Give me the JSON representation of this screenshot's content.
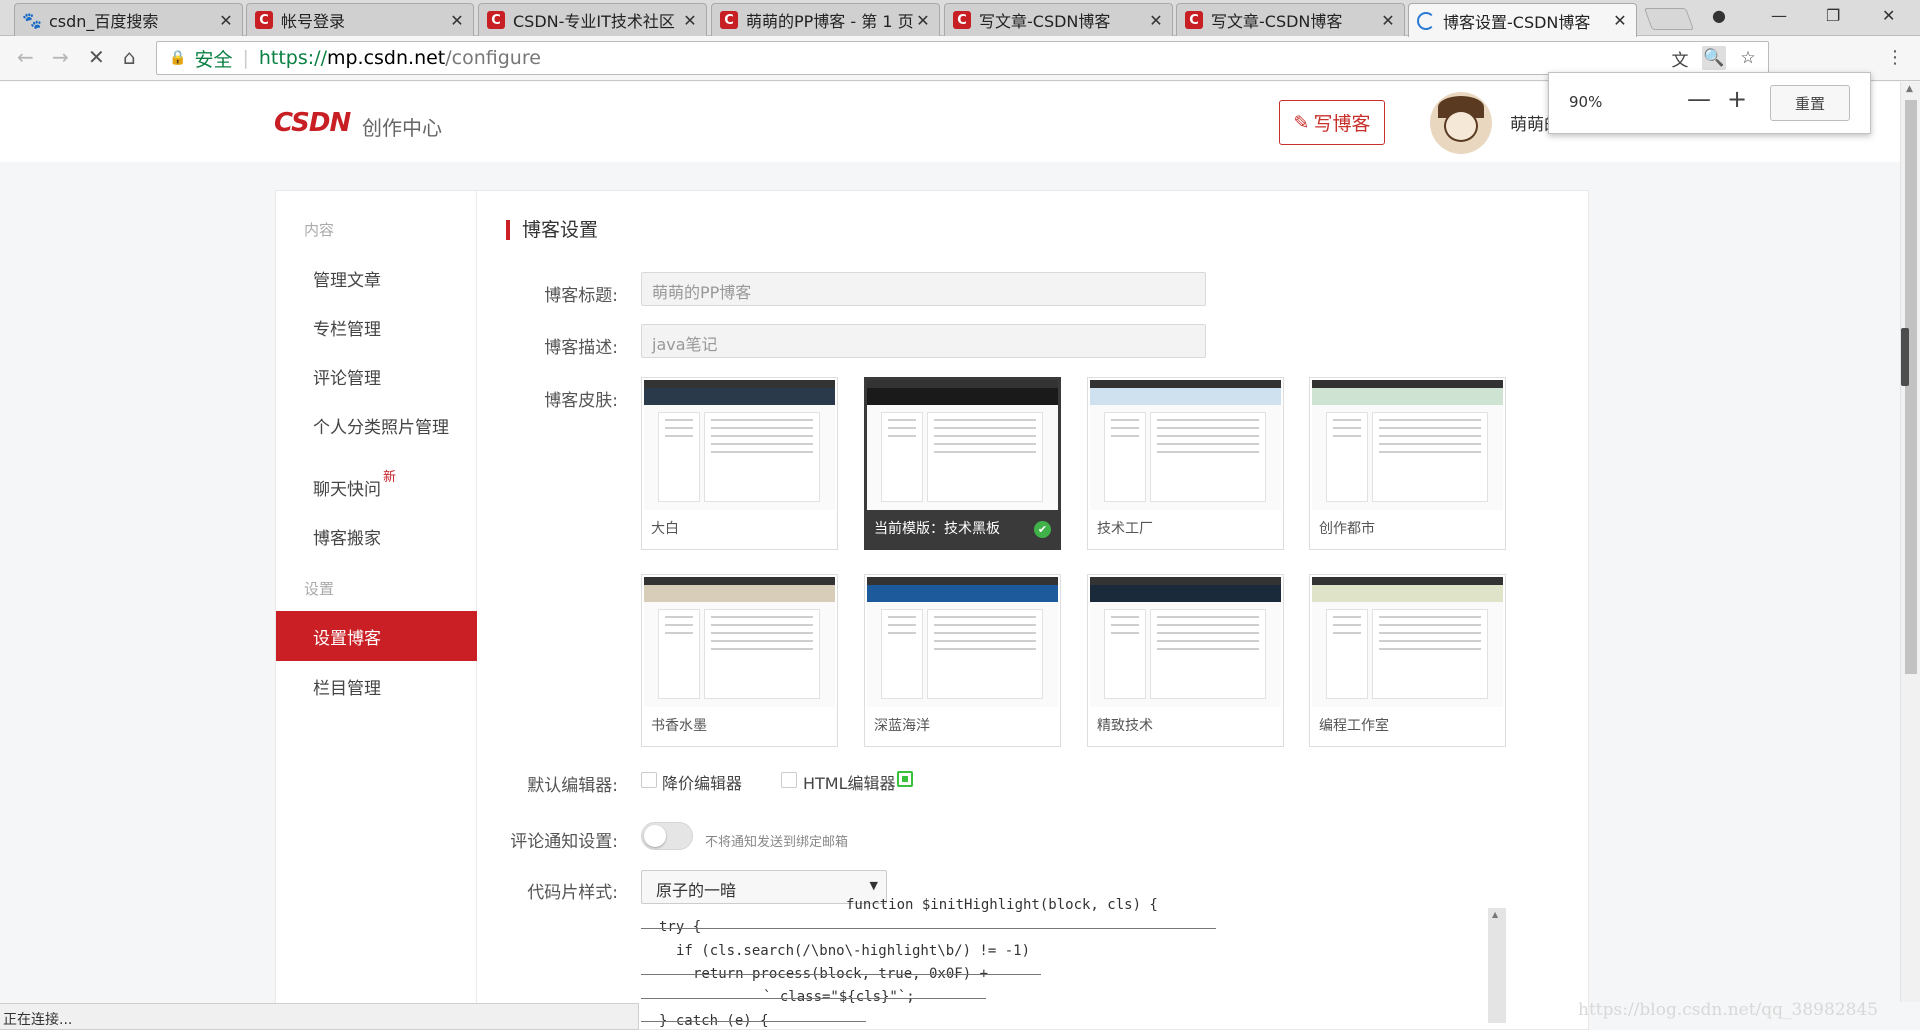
{
  "browser": {
    "tabs": [
      {
        "title": "csdn_百度搜索",
        "icon": "baidu-paw-icon"
      },
      {
        "title": "帐号登录",
        "icon": "csdn-c-icon"
      },
      {
        "title": "CSDN-专业IT技术社区",
        "icon": "csdn-c-icon"
      },
      {
        "title": "萌萌的PP博客 - 第 1 页",
        "icon": "csdn-c-icon"
      },
      {
        "title": "写文章-CSDN博客",
        "icon": "csdn-c-icon"
      },
      {
        "title": "写文章-CSDN博客",
        "icon": "csdn-c-icon"
      },
      {
        "title": "博客设置-CSDN博客",
        "icon": "loading-icon",
        "active": true
      }
    ],
    "address": {
      "secure_label": "安全",
      "url_proto": "https://",
      "url_host": "mp.csdn.net",
      "url_path": "/configure"
    },
    "zoom_popup": {
      "percent": "90%",
      "minus": "—",
      "plus": "+",
      "reset_label": "重置"
    },
    "status_text": "正在连接..."
  },
  "header": {
    "logo_text": "CSDN",
    "logo_sub": "创作中心",
    "write_button": "写博客",
    "username": "萌萌的"
  },
  "sidebar": {
    "group_content": "内容",
    "items_content": [
      "管理文章",
      "专栏管理",
      "评论管理",
      "个人分类照片管理",
      "聊天快问",
      "博客搬家"
    ],
    "new_tag": "新",
    "group_settings": "设置",
    "items_settings": [
      "设置博客",
      "栏目管理"
    ]
  },
  "settings": {
    "section_title": "博客设置",
    "title_label": "博客标题:",
    "title_value": "萌萌的PP博客",
    "desc_label": "博客描述:",
    "desc_value": "java笔记",
    "skin_label": "博客皮肤:",
    "skins": [
      {
        "name": "大白",
        "banner": "#2b3a4a",
        "current": false
      },
      {
        "name": "当前模版：技术黑板",
        "banner": "#1a1a1a",
        "current": true
      },
      {
        "name": "技术工厂",
        "banner": "#cfe0ef",
        "current": false
      },
      {
        "name": "创作都市",
        "banner": "#cfe3d3",
        "current": false
      },
      {
        "name": "书香水墨",
        "banner": "#d8cdb8",
        "current": false
      },
      {
        "name": "深蓝海洋",
        "banner": "#1d5a9c",
        "current": false
      },
      {
        "name": "精致技术",
        "banner": "#1b2a3a",
        "current": false
      },
      {
        "name": "编程工作室",
        "banner": "#dfe3c8",
        "current": false
      }
    ],
    "editor_label": "默认编辑器:",
    "editor_options": [
      {
        "label": "降价编辑器",
        "checked": false
      },
      {
        "label": "HTML编辑器",
        "checked": true
      }
    ],
    "notify_label": "评论通知设置:",
    "notify_hint": "不将通知发送到绑定邮箱",
    "notify_on": false,
    "code_label": "代码片样式:",
    "code_style": "原子的一暗",
    "code_lines": [
      "function $initHighlight(block, cls) {",
      "try {",
      "if (cls.search(/\\bno\\-highlight\\b/) != -1)",
      "return process(block, true, 0x0F) +",
      "` class=\"${cls}\"`;",
      "} catch (e) {"
    ]
  },
  "watermark": "https://blog.csdn.net/qq_38982845"
}
